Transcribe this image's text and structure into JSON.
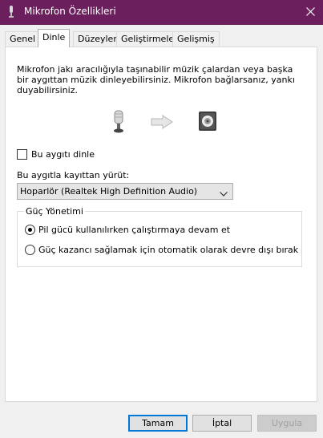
{
  "window": {
    "title": "Mikrofon Özellikleri",
    "icons": {
      "app": "microphone-icon",
      "close": "close-icon"
    }
  },
  "tabs": [
    {
      "label": "Genel",
      "active": false
    },
    {
      "label": "Dinle",
      "active": true
    },
    {
      "label": "Düzeyler",
      "active": false
    },
    {
      "label": "Geliştirmeler",
      "active": false
    },
    {
      "label": "Gelişmiş",
      "active": false
    }
  ],
  "listen": {
    "description": "Mikrofon jakı aracılığıyla taşınabilir müzik çalardan veya başka bir aygıttan müzik dinleyebilirsiniz. Mikrofon bağlarsanız, yankı duyabilirsiniz.",
    "illustration": [
      "microphone-icon",
      "arrow-right-icon",
      "speaker-icon"
    ],
    "checkbox_label": "Bu aygıtı dinle",
    "checkbox_checked": false,
    "playback_label": "Bu aygıtla kayıttan yürüt:",
    "playback_value": "Hoparlör (Realtek High Definition Audio)"
  },
  "power": {
    "legend": "Güç Yönetimi",
    "options": [
      {
        "label": "Pil gücü kullanılırken çalıştırmaya devam et",
        "selected": true
      },
      {
        "label": "Güç kazancı sağlamak için otomatik olarak devre dışı bırak",
        "selected": false
      }
    ]
  },
  "buttons": {
    "ok": "Tamam",
    "cancel": "İptal",
    "apply": "Uygula"
  },
  "colors": {
    "titlebar": "#6b1f5c",
    "accent": "#0078d7"
  }
}
